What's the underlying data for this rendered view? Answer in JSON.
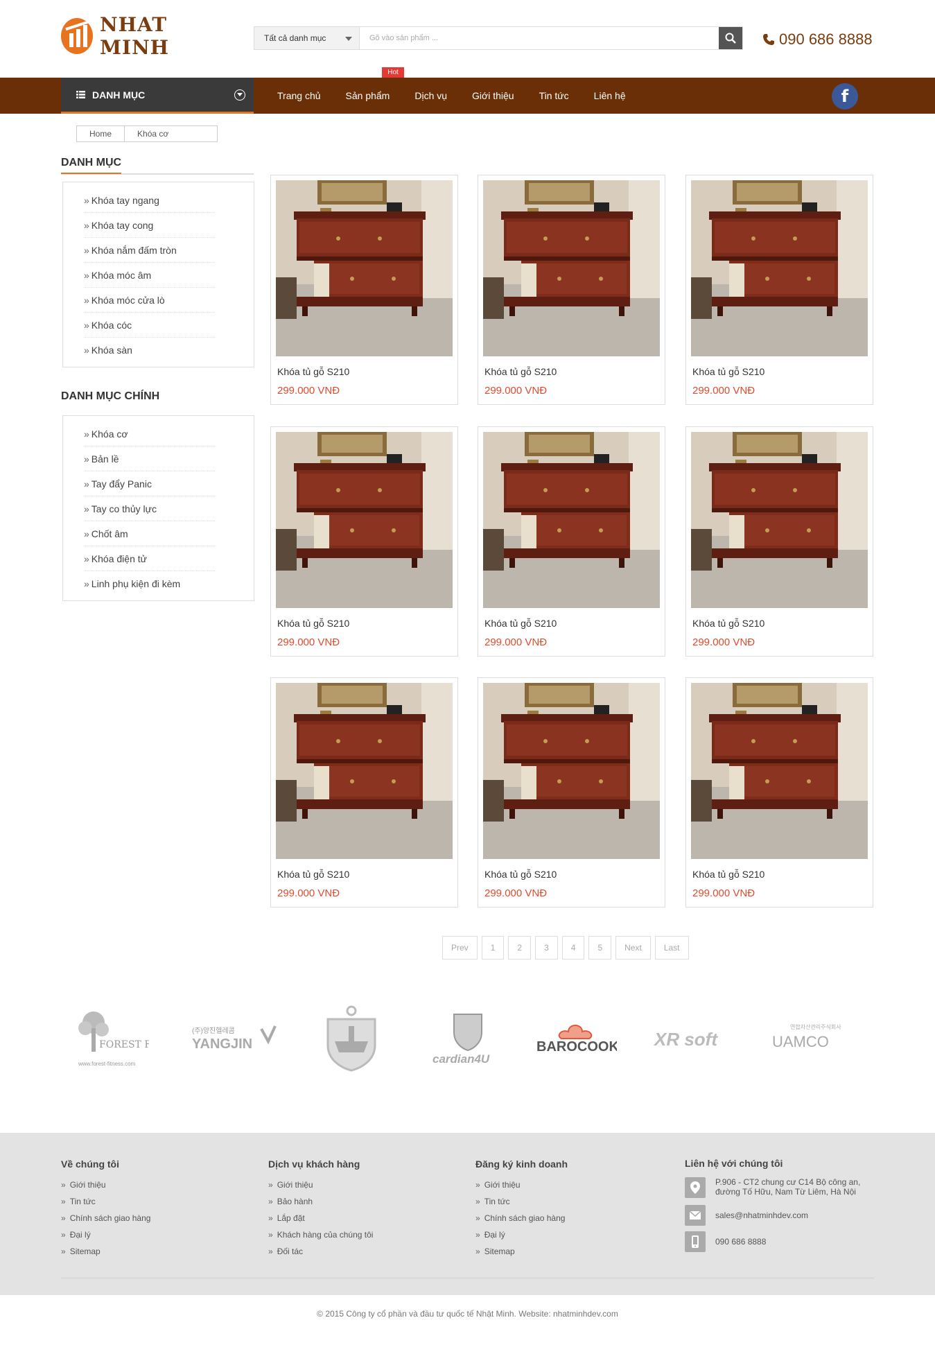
{
  "header": {
    "logo_text": "NHAT MINH",
    "search": {
      "category_label": "Tất cả danh mục",
      "placeholder": "Gõ vào sản phẩm ..."
    },
    "phone": "090 686 8888"
  },
  "nav": {
    "danh_muc_label": "DANH MỤC",
    "items": [
      "Trang chủ",
      "Sản phẩm",
      "Dịch vụ",
      "Giới thiệu",
      "Tin tức",
      "Liên hệ"
    ],
    "hot_badge": "Hot",
    "facebook_letter": "f"
  },
  "breadcrumb": [
    "Home",
    "Khóa cơ"
  ],
  "sidebar": {
    "title1": "DANH MỤC",
    "items1": [
      "Khóa tay ngang",
      "Khóa tay cong",
      "Khóa nắm đấm tròn",
      "Khóa móc âm",
      "Khóa móc cửa lò",
      "Khóa cóc",
      "Khóa sàn"
    ],
    "title2": "DANH MỤC CHÍNH",
    "items2": [
      "Khóa cơ",
      "Bản lề",
      "Tay đẩy Panic",
      "Tay co thủy lực",
      "Chốt âm",
      "Khóa điện tử",
      "Linh phụ kiện đi kèm"
    ]
  },
  "products": [
    {
      "name": "Khóa tủ gỗ S210",
      "price": "299.000 VNĐ"
    },
    {
      "name": "Khóa tủ gỗ S210",
      "price": "299.000 VNĐ"
    },
    {
      "name": "Khóa tủ gỗ S210",
      "price": "299.000 VNĐ"
    },
    {
      "name": "Khóa tủ gỗ S210",
      "price": "299.000 VNĐ"
    },
    {
      "name": "Khóa tủ gỗ S210",
      "price": "299.000 VNĐ"
    },
    {
      "name": "Khóa tủ gỗ S210",
      "price": "299.000 VNĐ"
    },
    {
      "name": "Khóa tủ gỗ S210",
      "price": "299.000 VNĐ"
    },
    {
      "name": "Khóa tủ gỗ S210",
      "price": "299.000 VNĐ"
    },
    {
      "name": "Khóa tủ gỗ S210",
      "price": "299.000 VNĐ"
    }
  ],
  "pagination": [
    "Prev",
    "1",
    "2",
    "3",
    "4",
    "5",
    "Next",
    "Last"
  ],
  "partners": [
    {
      "name": "FOREST FITNESS",
      "sub": "www.forest-fitness.com"
    },
    {
      "name": "YANGJIN",
      "sub": "(주)양진헬레콤"
    },
    {
      "name": "",
      "sub": ""
    },
    {
      "name": "cardian4U",
      "sub": ""
    },
    {
      "name": "BAROCOOK",
      "sub": ""
    },
    {
      "name": "XR soft",
      "sub": ""
    },
    {
      "name": "UAMCO",
      "sub": "연합자산관리주식회사"
    }
  ],
  "footer": {
    "col1": {
      "title": "Về chúng tôi",
      "links": [
        "Giới thiệu",
        "Tin tức",
        "Chính sách giao hàng",
        "Đại lý",
        "Sitemap"
      ]
    },
    "col2": {
      "title": "Dịch vụ khách hàng",
      "links": [
        "Giới thiệu",
        "Bảo hành",
        "Lắp đặt",
        "Khách hàng của chúng tôi",
        "Đối tác"
      ]
    },
    "col3": {
      "title": "Đăng ký kinh doanh",
      "links": [
        "Giới thiệu",
        "Tin tức",
        "Chính sách giao hàng",
        "Đại lý",
        "Sitemap"
      ]
    },
    "col4": {
      "title": "Liên hệ với chúng tôi",
      "address_line1": "P.906 - CT2 chung cư C14 Bộ công an,",
      "address_line2": "đường Tố Hữu, Nam Từ Liêm, Hà Nội",
      "email": "sales@nhatminhdev.com",
      "phone": "090 686 8888"
    },
    "copyright": "© 2015 Công ty cổ phần và đầu tư quốc tế Nhật Minh. Website: nhatminhdev.com"
  },
  "colors": {
    "brand_brown": "#6b2f07",
    "accent_orange": "#e8731f",
    "price_red": "#e14b2f"
  }
}
